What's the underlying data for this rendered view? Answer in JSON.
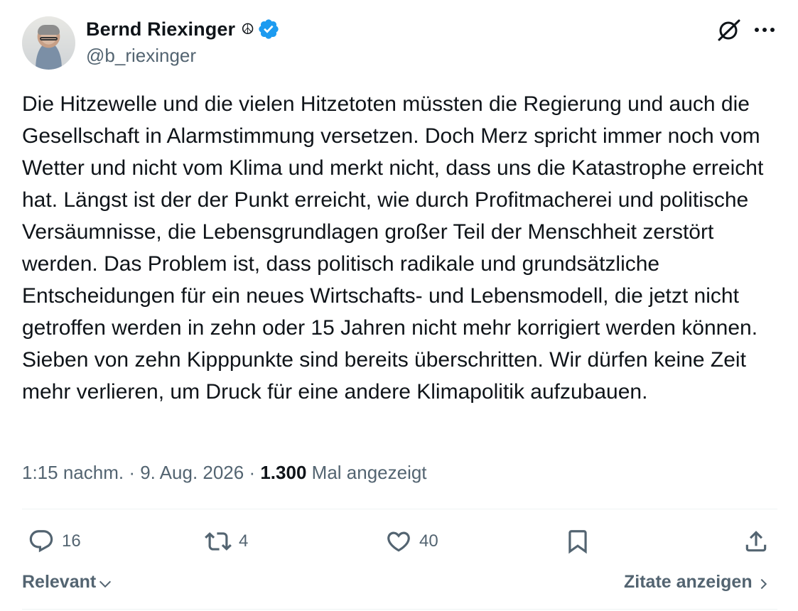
{
  "author": {
    "display_name": "Bernd Riexinger",
    "emoji": "☮",
    "handle": "@b_riexinger",
    "verified": true,
    "verified_color": "#1d9bf0"
  },
  "tweet": {
    "text": "Die Hitzewelle und die vielen Hitzetoten müssten die Regierung und auch die Gesellschaft in Alarmstimmung versetzen. Doch Merz spricht immer noch vom Wetter und nicht vom Klima und merkt nicht, dass uns die Katastrophe erreicht hat. Längst ist der der Punkt erreicht, wie durch Profitmacherei und politische Versäumnisse, die Lebensgrundlagen großer Teil der Menschheit zerstört werden. Das Problem ist, dass politisch radikale und grundsätzliche Entscheidungen für ein neues Wirtschafts- und Lebensmodell, die jetzt nicht getroffen werden in zehn oder 15 Jahren nicht mehr korrigiert werden können. Sieben von zehn Kipppunkte sind bereits überschritten. Wir dürfen keine Zeit mehr verlieren, um Druck für eine andere Klimapolitik aufzubauen.",
    "time": "1:15 nachm.",
    "separator": " · ",
    "date": "9. Aug. 2026",
    "views_count": "1.300",
    "views_label": "Mal angezeigt"
  },
  "actions": {
    "replies": "16",
    "retweets": "4",
    "likes": "40",
    "icons": [
      "reply-icon",
      "retweet-icon",
      "like-icon",
      "bookmark-icon",
      "share-icon"
    ]
  },
  "footer": {
    "sort_label": "Relevant",
    "quotes_label": "Zitate anzeigen"
  },
  "colors": {
    "text": "#0f1419",
    "secondary": "#536471",
    "divider": "#eff3f4"
  }
}
